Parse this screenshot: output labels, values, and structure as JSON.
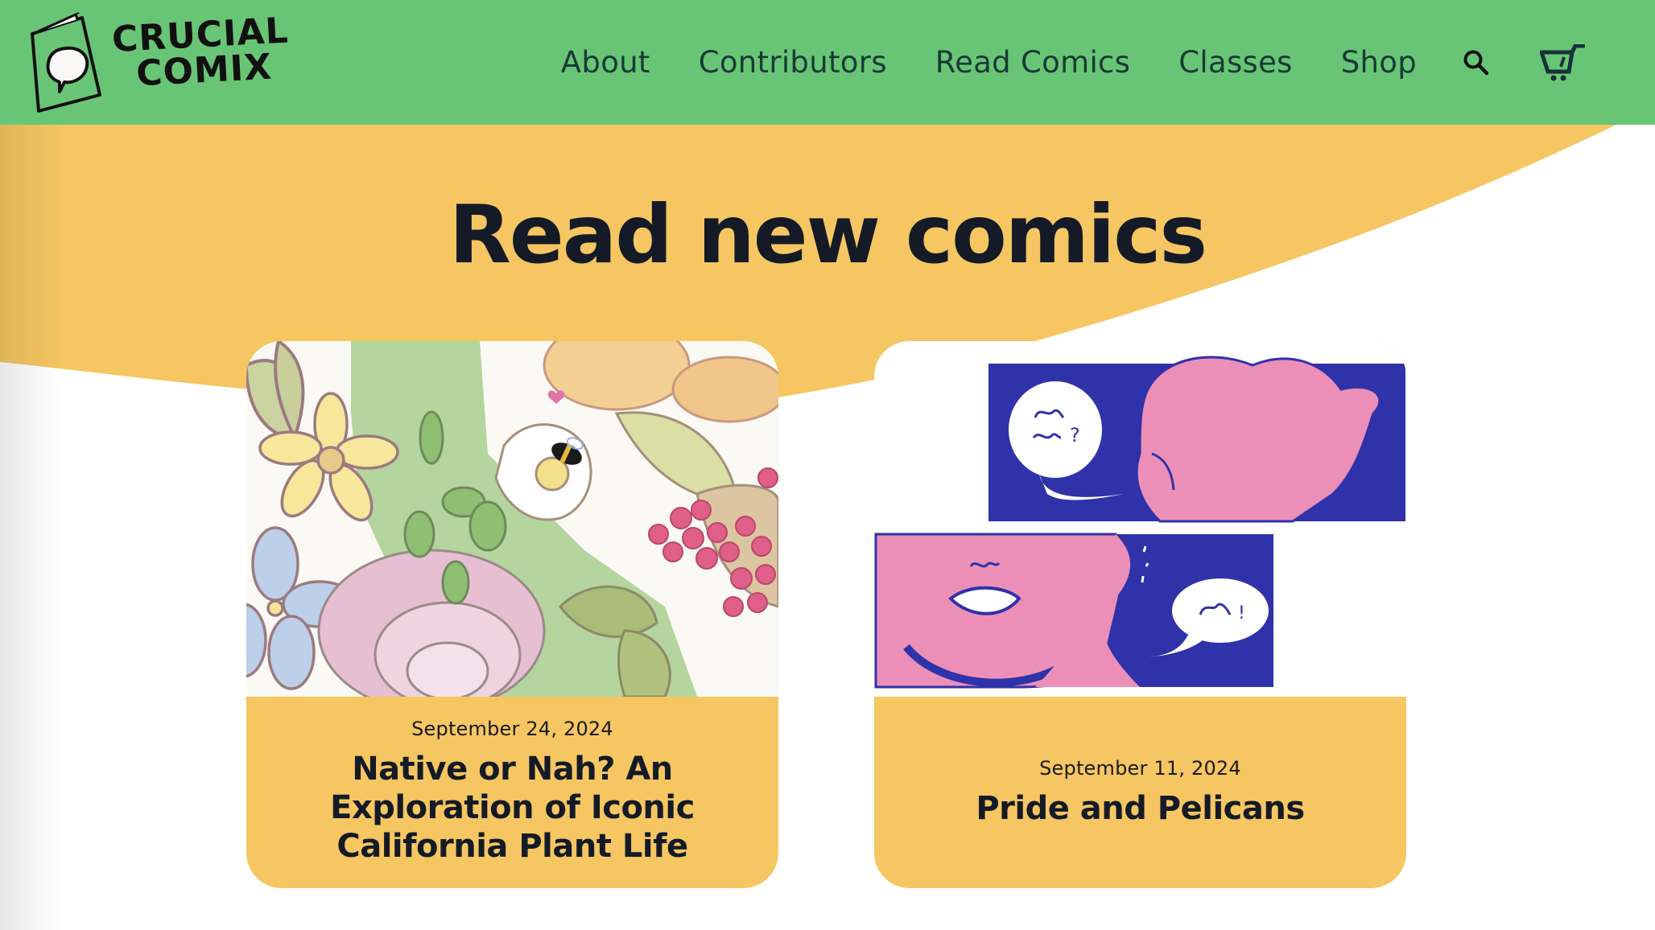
{
  "brand": {
    "name_line1": "CRUCIAL",
    "name_line2": "COMIX",
    "logo_icon": "comic-book-speech-bubble-icon"
  },
  "nav": {
    "items": [
      {
        "label": "About"
      },
      {
        "label": "Contributors"
      },
      {
        "label": "Read Comics"
      },
      {
        "label": "Classes"
      },
      {
        "label": "Shop"
      }
    ],
    "search_icon": "search-icon",
    "cart_icon": "shopping-cart-icon"
  },
  "hero": {
    "headline": "Read new comics"
  },
  "comics": [
    {
      "date": "September 24, 2024",
      "title": "Native or Nah? An Exploration of Iconic California Plant Life",
      "image_alt": "Illustration of California native flowers, berries and a bee"
    },
    {
      "date": "September 11, 2024",
      "title": "Pride and Pelicans",
      "image_alt": "Two comic panels in blue and pink with speech bubbles"
    }
  ],
  "colors": {
    "header_green": "#69c576",
    "accent_yellow": "#f5c662",
    "text_dark": "#141a26",
    "nav_text": "#173a36",
    "comic_blue": "#2f32a8",
    "comic_pink": "#ec8fb8"
  }
}
